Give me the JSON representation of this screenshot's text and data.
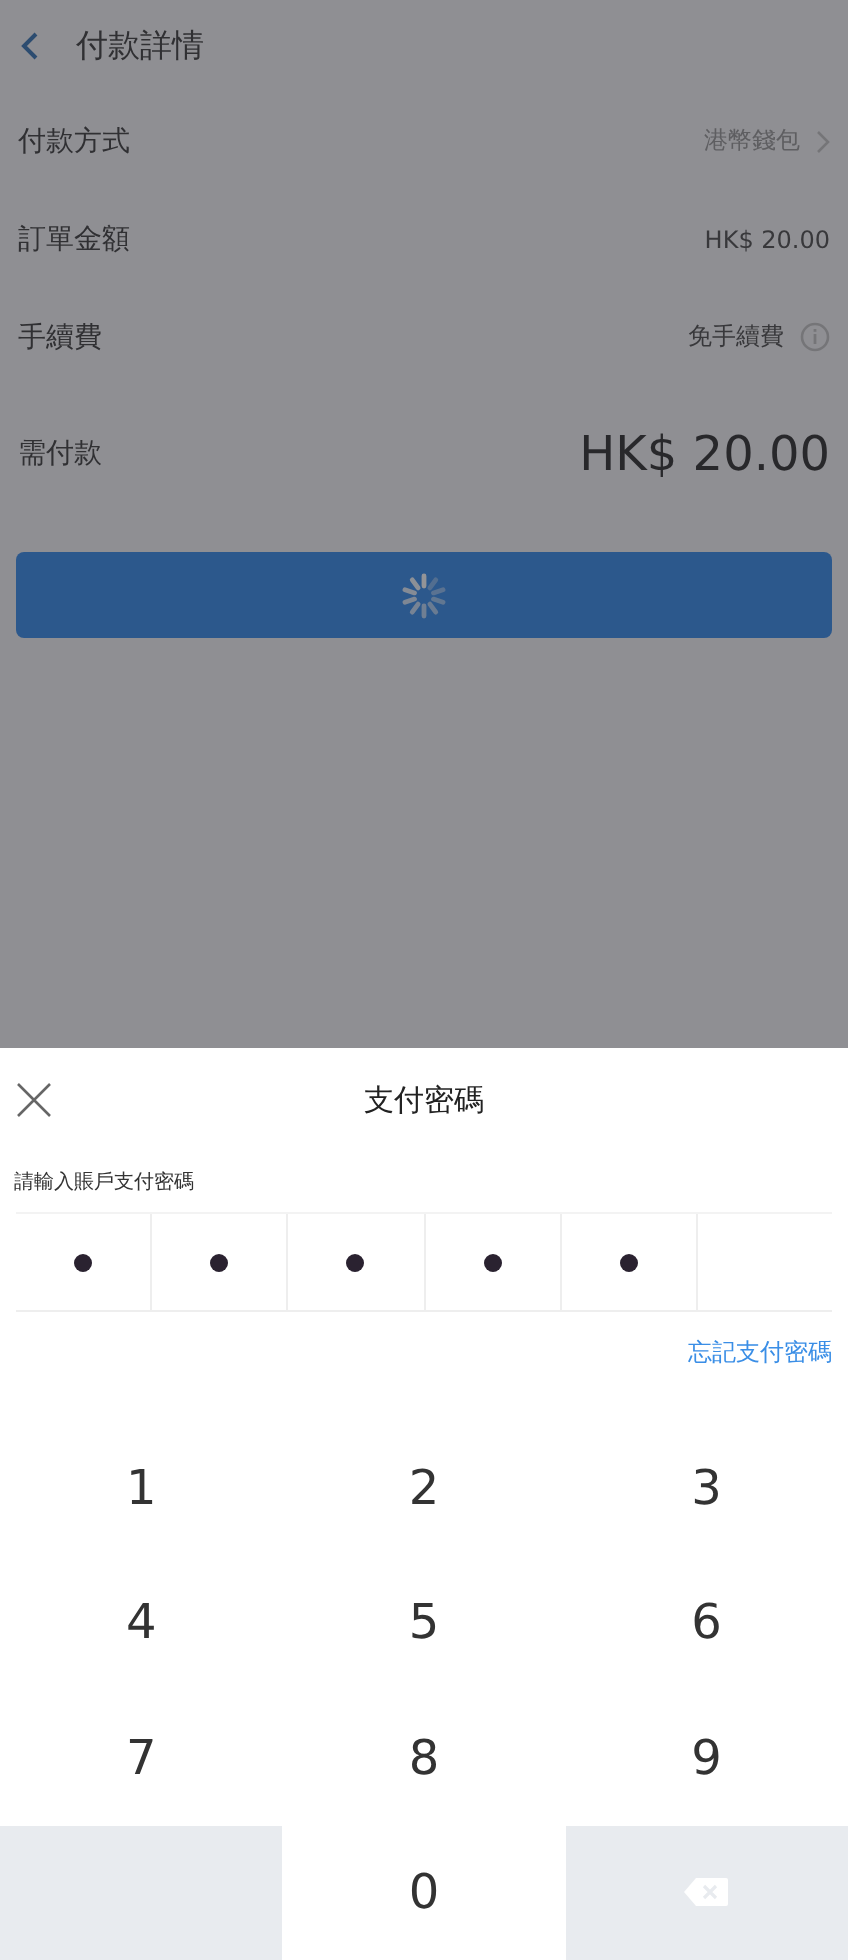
{
  "header": {
    "title": "付款詳情"
  },
  "rows": [
    {
      "label": "付款方式",
      "value": "港幣錢包",
      "kind": "link"
    },
    {
      "label": "訂單金額",
      "value": "HK$ 20.00",
      "kind": "plain"
    },
    {
      "label": "手續費",
      "value": "免手續費",
      "kind": "info"
    },
    {
      "label": "需付款",
      "value": "HK$ 20.00",
      "kind": "total"
    }
  ],
  "pay_button": {
    "loading": true
  },
  "sheet": {
    "title": "支付密碼",
    "prompt": "請輸入賬戶支付密碼",
    "pin_cells": [
      {
        "filled": true
      },
      {
        "filled": true
      },
      {
        "filled": true
      },
      {
        "filled": true
      },
      {
        "filled": true
      },
      {
        "filled": false
      }
    ],
    "forgot_link": "忘記支付密碼"
  },
  "keypad": [
    {
      "label": "1",
      "kind": "digit"
    },
    {
      "label": "2",
      "kind": "digit"
    },
    {
      "label": "3",
      "kind": "digit"
    },
    {
      "label": "4",
      "kind": "digit"
    },
    {
      "label": "5",
      "kind": "digit"
    },
    {
      "label": "6",
      "kind": "digit"
    },
    {
      "label": "7",
      "kind": "digit"
    },
    {
      "label": "8",
      "kind": "digit"
    },
    {
      "label": "9",
      "kind": "digit"
    },
    {
      "kind": "blank"
    },
    {
      "label": "0",
      "kind": "digit"
    },
    {
      "kind": "delete"
    }
  ]
}
